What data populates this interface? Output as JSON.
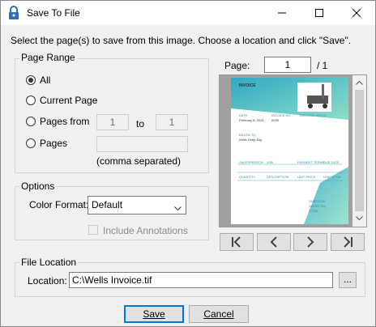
{
  "window": {
    "title": "Save To File"
  },
  "instructions": "Select the page(s) to save from this image. Choose a location and click \"Save\".",
  "page_range": {
    "label": "Page Range",
    "options": [
      "All",
      "Current Page",
      "Pages from",
      "Pages"
    ],
    "selected": "All",
    "from_value": "1",
    "to_label": "to",
    "to_value": "1",
    "comma_hint": "(comma separated)"
  },
  "options": {
    "label": "Options",
    "color_format_label": "Color Format:",
    "color_format_value": "Default",
    "include_annotations_label": "Include Annotations",
    "include_annotations_checked": false
  },
  "pager": {
    "label": "Page:",
    "current": "1",
    "total": "/ 1"
  },
  "preview": {
    "title": "INVOICE",
    "company": "TRENTON WELLS",
    "lines": [
      "DATE",
      "INVOICE NO",
      "February 8, 2024",
      "0035",
      "BILLED TO",
      "Wells Deep-Dig",
      "SALESPERSON",
      "JOB",
      "PAYMENT TERMS",
      "DUE DATE",
      "QUANTITY",
      "DESCRIPTION",
      "UNIT PRICE",
      "LINE TOTAL",
      "SUBTOTAL",
      "SALES TAX",
      "TOTAL"
    ]
  },
  "file_location": {
    "label": "File Location",
    "location_label": "Location:",
    "path": "C:\\Wells Invoice.tif",
    "browse_label": "..."
  },
  "buttons": {
    "save": "Save",
    "cancel": "Cancel"
  },
  "icons": [
    "lock-icon",
    "minimize-icon",
    "maximize-icon",
    "close-icon",
    "first-page-icon",
    "previous-page-icon",
    "next-page-icon",
    "last-page-icon",
    "dropdown-arrow-icon",
    "scroll-up-icon",
    "scroll-down-icon"
  ],
  "colors": {
    "accent": "#0078d7",
    "preview_teal": "#3aaec0"
  }
}
